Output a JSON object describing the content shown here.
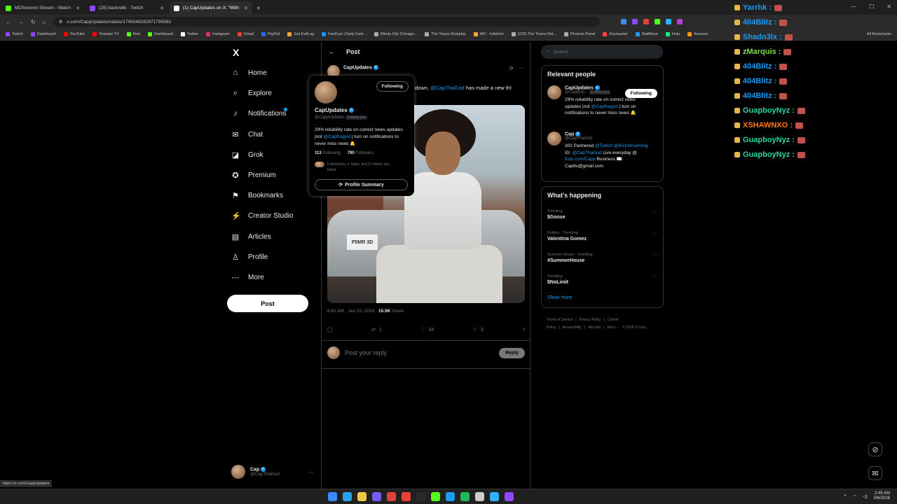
{
  "browser": {
    "tabs": [
      {
        "title": "MDSworvin Stream - Watch Li...",
        "color": "#53fc18",
        "active": false
      },
      {
        "title": "(28) backndtk - Twitch",
        "color": "#9146ff",
        "active": false
      },
      {
        "title": "(1) CapUpdates on X: \"With Li...",
        "color": "#ffffff",
        "active": true
      }
    ],
    "new_tab": "+",
    "url": "x.com/CappUpdates/status/1745048182671790583",
    "status_url": "https://x.com/CappUpdates",
    "bookmarks": [
      {
        "label": "Twitch",
        "color": "#9146ff"
      },
      {
        "label": "Dashboard",
        "color": "#9146ff"
      },
      {
        "label": "YouTube",
        "color": "#ff0000"
      },
      {
        "label": "Youtube TV",
        "color": "#ff0000"
      },
      {
        "label": "Kick",
        "color": "#53fc18"
      },
      {
        "label": "Dashboard",
        "color": "#53fc18"
      },
      {
        "label": "Twitter",
        "color": "#ffffff"
      },
      {
        "label": "Instagram",
        "color": "#e1306c"
      },
      {
        "label": "Gmail",
        "color": "#ea4335"
      },
      {
        "label": "PayPal",
        "color": "#1d6ee6"
      },
      {
        "label": "Get ExitLag",
        "color": "#f2a43a"
      },
      {
        "label": "FanDuel | Daily Fant...",
        "color": "#1493ff"
      },
      {
        "label": "Windy City Chicago...",
        "color": "#aaaaaa"
      },
      {
        "label": "The Towns Roleplay",
        "color": "#aaaaaa"
      },
      {
        "label": "WC - txAdmin",
        "color": "#f2a43a"
      },
      {
        "label": "(225) The Towns Rol...",
        "color": "#aaaaaa"
      },
      {
        "label": "Phoenix Panel",
        "color": "#aaaaaa"
      },
      {
        "label": "Keymaster",
        "color": "#ff4444"
      },
      {
        "label": "StatMuse",
        "color": "#1d9bf0"
      },
      {
        "label": "Hulu",
        "color": "#1ce783"
      },
      {
        "label": "Amazon",
        "color": "#ff9900"
      }
    ],
    "all_bookmarks": "All Bookmarks"
  },
  "leftnav": {
    "logo": "X",
    "items": [
      {
        "label": "Home",
        "icon": "⌂",
        "name": "home"
      },
      {
        "label": "Explore",
        "icon": "⌕",
        "name": "explore"
      },
      {
        "label": "Notifications",
        "icon": "♪",
        "name": "notifications"
      },
      {
        "label": "Chat",
        "icon": "✉",
        "name": "chat"
      },
      {
        "label": "Grok",
        "icon": "◪",
        "name": "grok"
      },
      {
        "label": "Premium",
        "icon": "✪",
        "name": "premium"
      },
      {
        "label": "Bookmarks",
        "icon": "⚑",
        "name": "bookmarks"
      },
      {
        "label": "Creator Studio",
        "icon": "⚡",
        "name": "creator-studio"
      },
      {
        "label": "Articles",
        "icon": "▤",
        "name": "articles"
      },
      {
        "label": "Profile",
        "icon": "♙",
        "name": "profile"
      },
      {
        "label": "More",
        "icon": "⋯",
        "name": "more"
      }
    ],
    "post_button": "Post",
    "account": {
      "name": "Cap",
      "handle": "@CapThaGod"
    }
  },
  "post": {
    "header": "Post",
    "author_name": "CapUpdates",
    "text_prefix": "down,",
    "text_mention": "@CapThaGod",
    "text_suffix": "has made a new th!",
    "plate": "P5MR 3D",
    "meta_time": "6:41 AM · Jan 10, 2024 ·",
    "meta_views_count": "15.5K",
    "meta_views_label": "Views",
    "reposts": "1",
    "likes": "34",
    "bookmarks": "3",
    "reply_placeholder": "Post your reply",
    "reply_button": "Reply"
  },
  "hovercard": {
    "follow_state": "Following",
    "name": "CapUpdates",
    "handle": "@CappUpdates",
    "follows_you": "Follows you",
    "bio_1": "29% reliability rate on correct news updates |not",
    "bio_mention": "@Capthagod",
    "bio_2": "| turn on notifications to never miss news 🔔",
    "following_count": "113",
    "following_label": "Following",
    "followers_count": "790",
    "followers_label": "Followers",
    "followed_by": "Followed by ✈ Sizko, and 67 others you follow",
    "profile_summary": "Profile Summary"
  },
  "right": {
    "search_placeholder": "Search",
    "relevant_title": "Relevant people",
    "people": [
      {
        "name": "CapUpdates",
        "handle": "@CappUp...",
        "badge": "Follows you",
        "bio_1": "29% reliability rate on correct news updates |not",
        "bio_mention": "@Capthagod",
        "bio_2": "| turn on notifications to never miss news 🔔",
        "follow": "Following"
      },
      {
        "name": "Cap",
        "handle": "@CapThaGod",
        "bio_1": "302 Partnered",
        "bio_mention": "@Twitch @KickStreaming",
        "bio_2": "IG:",
        "bio_mention2": "@CapThaGod",
        "bio_3": "Live everyday @",
        "bio_mention3": "Kick.com/Capp",
        "bio_4": "Business ✉️: Capttv@gmail.com"
      }
    ],
    "happening_title": "What’s happening",
    "trends": [
      {
        "category": "Trending",
        "topic": "$Goose"
      },
      {
        "category": "Politics · Trending",
        "topic": "Valentina Gomez"
      },
      {
        "category": "Summer House · Trending",
        "topic": "#SummerHouse"
      },
      {
        "category": "Trending",
        "topic": "$NoLimit"
      }
    ],
    "show_more": "Show more",
    "footer": [
      "Terms of Service",
      "|",
      "Privacy Policy",
      "|",
      "Cookie Policy",
      "|",
      "Accessibility",
      "|",
      "Ads info",
      "|",
      "More ···",
      "© 2026 X Corp."
    ]
  },
  "chat_overlay": [
    {
      "user": "Yarrhk :",
      "color": "#1d9bf0"
    },
    {
      "user": "404Blitz :",
      "color": "#1d9bf0"
    },
    {
      "user": "Shadn3lx :",
      "color": "#1d9bf0"
    },
    {
      "user": "zMarquis :",
      "color": "#7ddc4c"
    },
    {
      "user": "404Blitz :",
      "color": "#1d9bf0"
    },
    {
      "user": "404Blitz :",
      "color": "#1d9bf0"
    },
    {
      "user": "404Blitz :",
      "color": "#1d9bf0"
    },
    {
      "user": "GuapboyNyz :",
      "color": "#2fd3a2"
    },
    {
      "user": "XSHAWNXO :",
      "color": "#ff7a1a"
    },
    {
      "user": "GuapboyNyz :",
      "color": "#2fd3a2"
    },
    {
      "user": "GuapboyNyz :",
      "color": "#2fd3a2"
    }
  ],
  "taskbar": {
    "apps": [
      "#3b8bff",
      "#2aa3e8",
      "#f2c744",
      "#7b5cf5",
      "#e0413b",
      "#ea4335",
      "#2b2b2b",
      "#53fc18",
      "#1d9bf0",
      "#1db954",
      "#cccccc",
      "#2fb1ff",
      "#9146ff"
    ],
    "time": "2:45 AM",
    "date": "3/6/2026"
  },
  "icons": {
    "side_top": "grok-icon",
    "side_bottom": "messages-icon"
  }
}
